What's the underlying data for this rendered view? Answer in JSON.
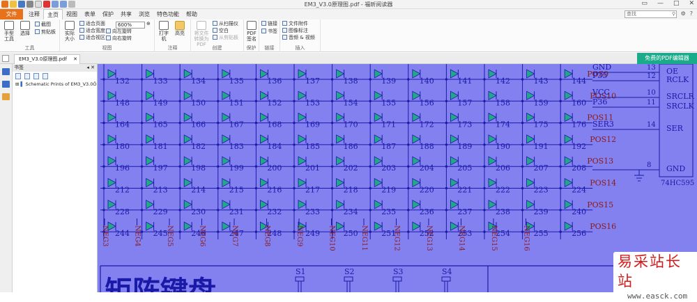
{
  "window": {
    "title": "EM3_V3.0原理图.pdf - 福昕阅读器"
  },
  "menu": {
    "file": "文件",
    "tabs": [
      "注释",
      "主页",
      "视图",
      "表单",
      "保护",
      "共享",
      "浏览",
      "特色功能",
      "帮助"
    ],
    "active_tab": 1
  },
  "search": {
    "placeholder": "查找"
  },
  "ribbon": {
    "tools": {
      "hand": "手型工具",
      "select": "选择",
      "snapshot": "截图",
      "clipboard": "剪贴板",
      "label": "工具"
    },
    "view": {
      "actual_size": "实际大小",
      "fit_page": "适合页面",
      "fit_width": "适合宽度",
      "fit_visible": "适合视区",
      "zoom": "600%",
      "rotate_left": "向左旋转",
      "rotate_right": "向右旋转",
      "label": "视图"
    },
    "comment": {
      "typewriter": "打字机",
      "highlight": "高亮",
      "label": "注释"
    },
    "create": {
      "convert": "将文件转换为PDF",
      "from_scanner": "从扫描仪",
      "blank": "空白",
      "from_clipboard": "从剪贴板",
      "label": "创建"
    },
    "protect": {
      "sign": "PDF签名",
      "label": "保护"
    },
    "links": {
      "link": "链接",
      "bookmark": "书签",
      "label": "链接"
    },
    "insert": {
      "attachment": "文件附件",
      "image_annot": "图像标注",
      "audio_video": "音频 & 视频",
      "label": "插入"
    }
  },
  "doc_tab": {
    "name": "EM3_V3.0原理图.pdf"
  },
  "promo": {
    "label": "免费的PDF编辑器"
  },
  "bookmarks": {
    "title": "书签",
    "item": "Schematic Prints of EM3_V3.0Ö Al"
  },
  "schematic": {
    "pos_labels": [
      "POS9",
      "POS10",
      "POS11",
      "POS12",
      "POS13",
      "POS14",
      "POS15",
      "POS16"
    ],
    "neg_labels": [
      "NEG3",
      "NEG4",
      "NEG5",
      "NEG6",
      "NEG7",
      "NEG8",
      "NEG9",
      "NEG10",
      "NEG11",
      "NEG12",
      "NEG13",
      "NEG14",
      "NEG15",
      "NEG16"
    ],
    "led_rows": [
      [
        132,
        133,
        134,
        135,
        136,
        137,
        138,
        139,
        140,
        141,
        142,
        143,
        144
      ],
      [
        148,
        149,
        150,
        151,
        152,
        153,
        154,
        155,
        156,
        157,
        158,
        159,
        160
      ],
      [
        164,
        165,
        166,
        167,
        168,
        169,
        170,
        171,
        172,
        173,
        174,
        175,
        176
      ],
      [
        180,
        181,
        182,
        183,
        184,
        185,
        186,
        187,
        188,
        189,
        190,
        191,
        192
      ],
      [
        196,
        197,
        198,
        199,
        200,
        201,
        202,
        203,
        204,
        205,
        206,
        207,
        208
      ],
      [
        212,
        213,
        214,
        215,
        216,
        217,
        218,
        219,
        220,
        221,
        222,
        223,
        224
      ],
      [
        228,
        229,
        230,
        231,
        232,
        233,
        234,
        235,
        236,
        237,
        238,
        239,
        240
      ],
      [
        244,
        245,
        246,
        247,
        248,
        249,
        250,
        251,
        252,
        253,
        254,
        255,
        256
      ]
    ],
    "ic": {
      "part": "74HC595",
      "pins": [
        {
          "net": "GND",
          "num": "13",
          "name": "OE"
        },
        {
          "net": "P35",
          "num": "12",
          "name": "RCLK"
        },
        {
          "net": "VCC",
          "num": "10",
          "name": "SRCLR"
        },
        {
          "net": "P36",
          "num": "11",
          "name": "SRCLK"
        },
        {
          "net": "SER3",
          "num": "14",
          "name": "SER"
        },
        {
          "net": "",
          "num": "8",
          "name": "GND"
        }
      ]
    },
    "switches": [
      "S1",
      "S2",
      "S3",
      "S4"
    ],
    "big_text": "矩阵键盘"
  },
  "watermark": {
    "site": "易采站长站",
    "url": "www.easck.com"
  },
  "colors": {
    "accent": "#e8711b",
    "promo": "#1aab8a",
    "canvas": "#8380f0",
    "wire": "#1a1aa8",
    "led": "#22a888",
    "label": "#8b1a1a"
  }
}
